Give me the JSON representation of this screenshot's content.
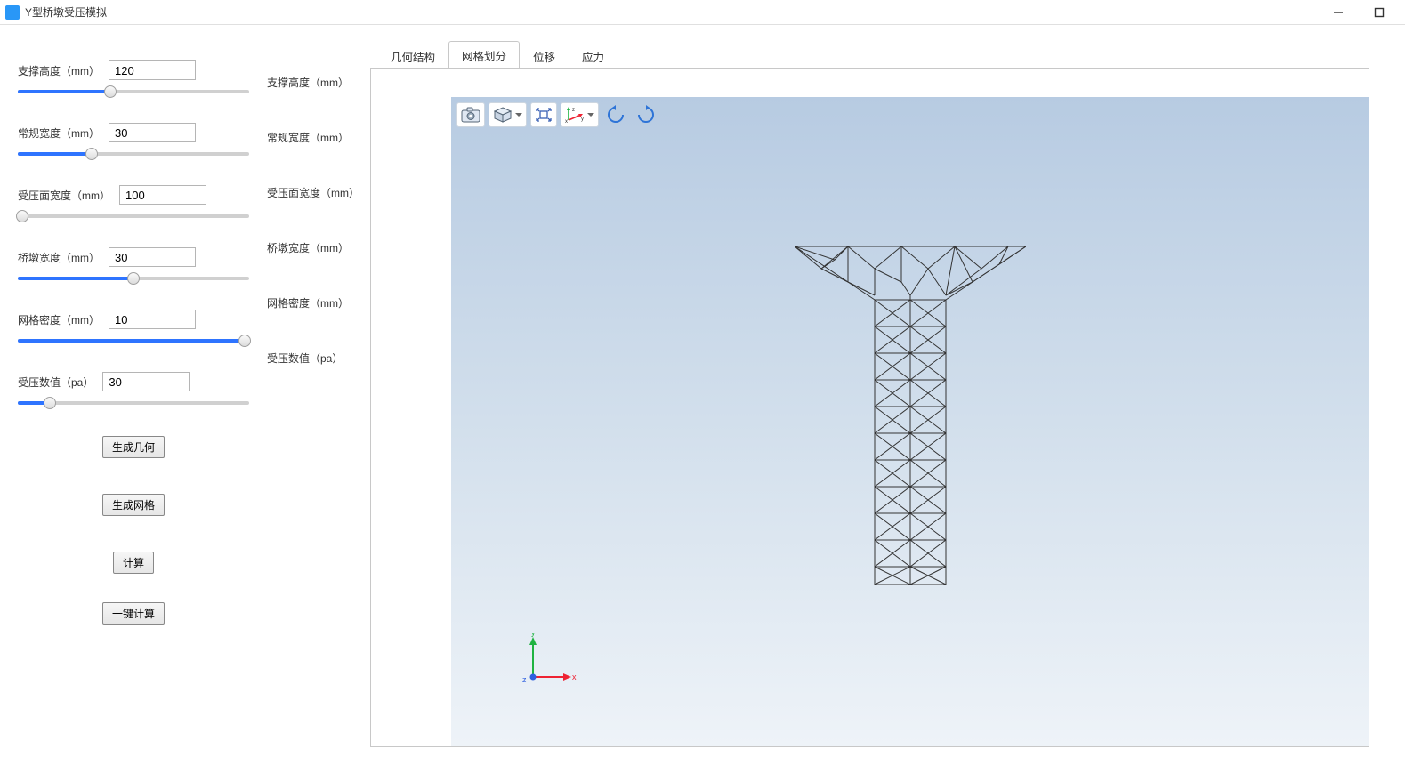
{
  "app": {
    "title": "Y型桥墩受压模拟"
  },
  "window_controls": {
    "minimize": "minimize",
    "maximize": "maximize",
    "close": "close"
  },
  "params": [
    {
      "label": "支撑高度（mm）",
      "value": "120",
      "fill_pct": 40,
      "thumb_pct": 40
    },
    {
      "label": "常规宽度（mm）",
      "value": "30",
      "fill_pct": 32,
      "thumb_pct": 32
    },
    {
      "label": "受压面宽度（mm）",
      "value": "100",
      "fill_pct": 2,
      "thumb_pct": 2
    },
    {
      "label": "桥墩宽度（mm）",
      "value": "30",
      "fill_pct": 50,
      "thumb_pct": 50
    },
    {
      "label": "网格密度（mm）",
      "value": "10",
      "fill_pct": 98,
      "thumb_pct": 98
    },
    {
      "label": "受压数值（pa）",
      "value": "30",
      "fill_pct": 14,
      "thumb_pct": 14
    }
  ],
  "mid_labels": [
    "支撑高度（mm）",
    "常规宽度（mm）",
    "受压面宽度（mm）",
    "桥墩宽度（mm）",
    "网格密度（mm）",
    "受压数值（pa）"
  ],
  "buttons": {
    "gen_geometry": "生成几何",
    "gen_mesh": "生成网格",
    "compute": "计算",
    "compute_all": "一键计算"
  },
  "tabs": [
    {
      "label": "几何结构",
      "active": false
    },
    {
      "label": "网格划分",
      "active": true
    },
    {
      "label": "位移",
      "active": false
    },
    {
      "label": "应力",
      "active": false
    }
  ],
  "viewport_toolbar": [
    {
      "name": "snapshot-icon"
    },
    {
      "name": "scene-preset-icon",
      "dropdown": true
    },
    {
      "name": "zoom-extents-icon"
    },
    {
      "name": "axes-xyz-icon",
      "dropdown": true
    },
    {
      "name": "rotate-ccw-icon"
    },
    {
      "name": "rotate-cw-icon"
    }
  ],
  "triad": {
    "x": "x",
    "y": "y",
    "z": "z"
  }
}
